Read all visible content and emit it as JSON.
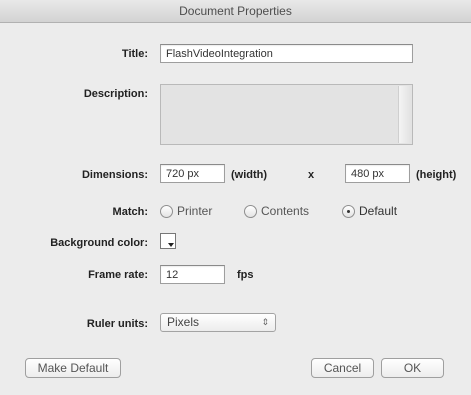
{
  "window": {
    "title": "Document Properties"
  },
  "labels": {
    "title": "Title:",
    "description": "Description:",
    "dimensions": "Dimensions:",
    "match": "Match:",
    "background_color": "Background color:",
    "frame_rate": "Frame rate:",
    "ruler_units": "Ruler units:"
  },
  "fields": {
    "title_value": "FlashVideoIntegration",
    "description_value": "",
    "width_value": "720 px",
    "height_value": "480 px",
    "frame_rate_value": "12"
  },
  "units": {
    "width": "(width)",
    "times": "x",
    "height": "(height)",
    "fps": "fps"
  },
  "match_options": [
    {
      "label": "Printer",
      "selected": false
    },
    {
      "label": "Contents",
      "selected": false
    },
    {
      "label": "Default",
      "selected": true
    }
  ],
  "background_color": "#ffffff",
  "ruler_units": {
    "selected": "Pixels"
  },
  "buttons": {
    "make_default": "Make Default",
    "cancel": "Cancel",
    "ok": "OK"
  }
}
